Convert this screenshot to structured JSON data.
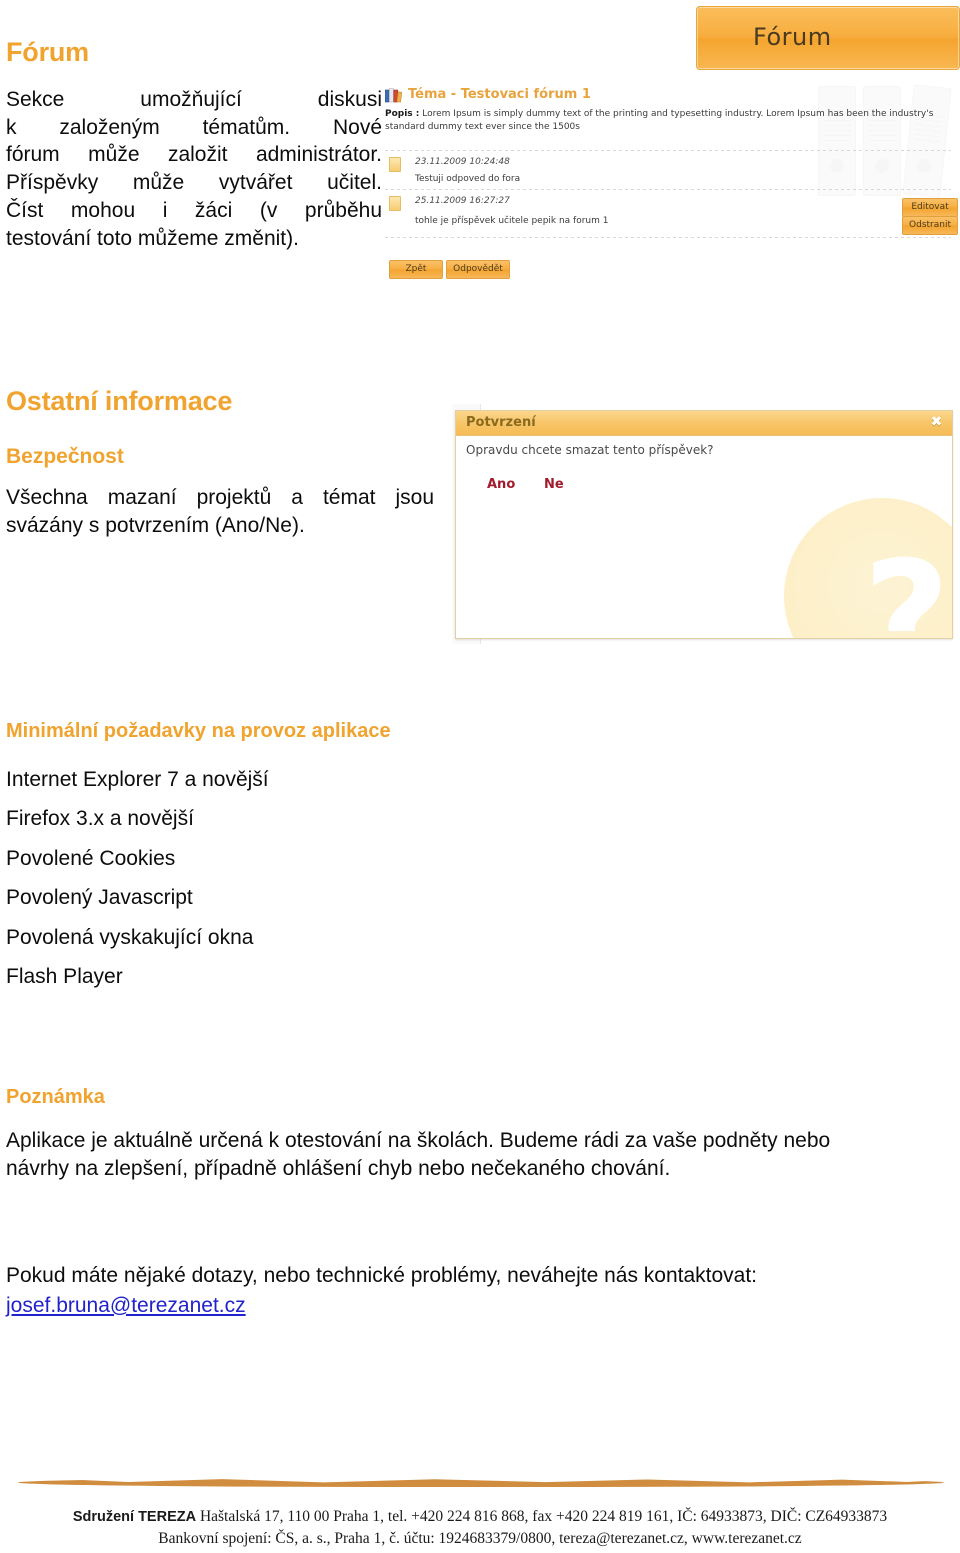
{
  "document": {
    "language": "cs"
  },
  "forum_section": {
    "heading": "Fórum",
    "paragraph_lines": [
      "Sekce umožňující diskusi",
      "k založeným tématům. Nové",
      "fórum může založit administrátor.",
      "Příspěvky může vytvářet učitel.",
      "Číst mohou i žáci (v průběhu",
      "testování toto můžeme změnit)."
    ]
  },
  "forum_app_screenshot": {
    "banner_label": "Fórum",
    "topic_heading": "Téma - Testovaci fórum 1",
    "description_label": "Popis :",
    "description_text": "Lorem Ipsum is simply dummy text of the printing and typesetting industry. Lorem Ipsum has been the industry's standard dummy text ever since the 1500s",
    "posts": [
      {
        "date": "23.11.2009 10:24:48",
        "body": "Testuji odpoved do fora"
      },
      {
        "date": "25.11.2009 16:27:27",
        "body": "tohle je příspěvek učitele pepik na forum 1"
      }
    ],
    "buttons": {
      "edit": "Editovat",
      "delete": "Odstranit",
      "back": "Zpět",
      "reply": "Odpovědět"
    }
  },
  "other_info_section": {
    "heading": "Ostatní informace",
    "security_heading": "Bezpečnost",
    "security_paragraph_lines": [
      "Všechna mazaní projektů a témat jsou",
      "svázány s potvrzením (Ano/Ne)."
    ]
  },
  "confirm_dialog_screenshot": {
    "title": "Potvrzení",
    "close_icon": "✖",
    "question": "Opravdu chcete smazat tento příspěvek?",
    "yes_label": "Ano",
    "no_label": "Ne",
    "watermark_glyph": "?"
  },
  "requirements_section": {
    "heading": "Minimální požadavky na provoz aplikace",
    "items": [
      "Internet Explorer 7 a novější",
      "Firefox 3.x a novější",
      "Povolené Cookies",
      "Povolený Javascript",
      "Povolená vyskakující okna",
      "Flash Player"
    ]
  },
  "note_section": {
    "heading": "Poznámka",
    "note_lines": [
      "Aplikace je aktuálně určená k otestování na školách. Budeme rádi za vaše podněty nebo",
      "návrhy na zlepšení, případně ohlášení chyb nebo nečekaného chování."
    ],
    "contact_intro": "Pokud máte nějaké dotazy, nebo technické problémy, neváhejte nás kontaktovat:",
    "contact_email": "josef.bruna@terezanet.cz"
  },
  "footer": {
    "org_name": "Sdružení TEREZA",
    "line_1_rest": "Haštalská 17, 110 00  Praha 1, tel. +420 224 816 868, fax +420 224 819 161, IČ: 64933873, DIČ: CZ64933873",
    "line_2": "Bankovní spojení: ČS, a. s., Praha 1, č. účtu: 1924683379/0800, tereza@terezanet.cz, www.terezanet.cz"
  },
  "colors": {
    "heading_orange": "#f0a32e",
    "link_blue": "#2222cc",
    "dialog_accent": "#a11c2c",
    "footer_rule": "#d18d3f"
  }
}
